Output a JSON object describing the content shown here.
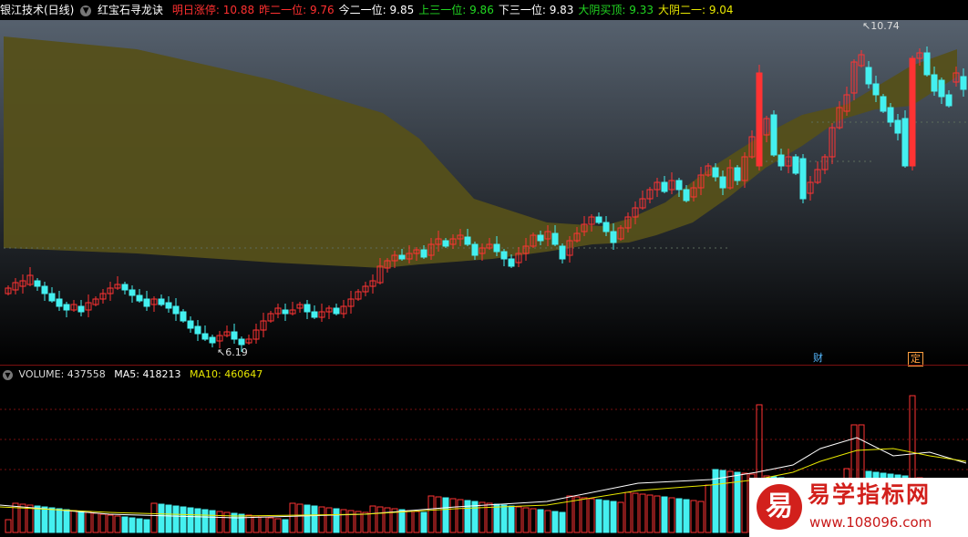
{
  "header": {
    "app_title": "银江技术(日线)",
    "indicator_name": "红宝石寻龙诀",
    "readouts": [
      {
        "label": "明日涨停: ",
        "value": "10.88",
        "color": "#ff3030"
      },
      {
        "label": "昨二一位: ",
        "value": "9.76",
        "color": "#ff3030"
      },
      {
        "label": "今二一位: ",
        "value": "9.85",
        "color": "#ffffff"
      },
      {
        "label": "上三一位: ",
        "value": "9.86",
        "color": "#22d822"
      },
      {
        "label": "下三一位: ",
        "value": "9.83",
        "color": "#ffffff"
      },
      {
        "label": "大阴买顶: ",
        "value": "9.33",
        "color": "#22d822"
      },
      {
        "label": "大阴二一: ",
        "value": "9.04",
        "color": "#e8e800"
      }
    ]
  },
  "price_chart": {
    "high_label": "10.74",
    "low_label": "6.19",
    "tags": [
      {
        "text": "财",
        "color": "#55b8ff"
      },
      {
        "text": "定",
        "color": "#ffa040"
      }
    ]
  },
  "volume": {
    "label": "VOLUME: ",
    "value": "437558",
    "ma5_label": "MA5: ",
    "ma5_value": "418213",
    "ma10_label": "MA10: ",
    "ma10_value": "460647",
    "ma5_color": "#ffffff",
    "ma10_color": "#e8e800"
  },
  "colors": {
    "up": "#ff3333",
    "down": "#44f0f0",
    "band": "#55501a",
    "grid": "#7a1010"
  },
  "watermark": {
    "logo_char": "易",
    "title": "易学指标网",
    "url": "www.108096.com"
  }
}
